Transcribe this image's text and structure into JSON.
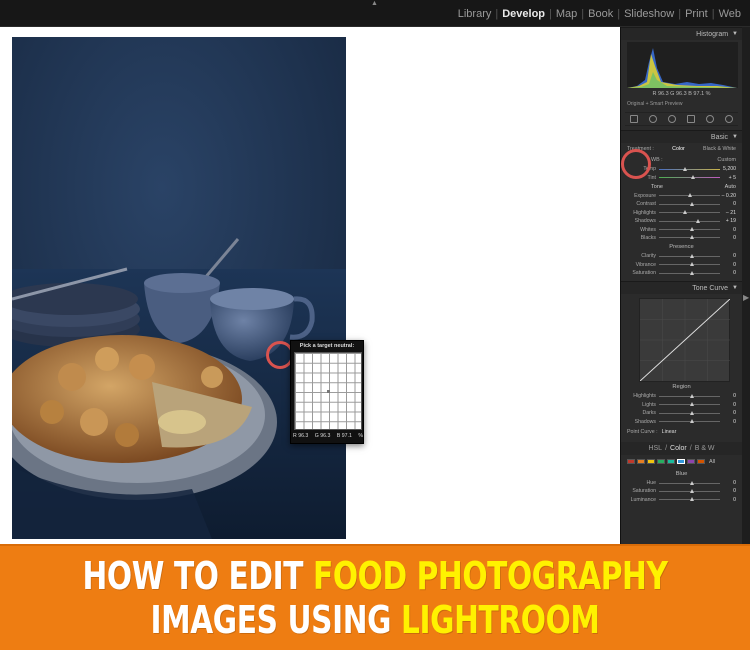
{
  "app": {
    "notch": "▲",
    "modules": [
      {
        "label": "Library",
        "active": false
      },
      {
        "label": "Develop",
        "active": true
      },
      {
        "label": "Map",
        "active": false
      },
      {
        "label": "Book",
        "active": false
      },
      {
        "label": "Slideshow",
        "active": false
      },
      {
        "label": "Print",
        "active": false
      },
      {
        "label": "Web",
        "active": false
      }
    ]
  },
  "loupe": {
    "title": "Pick a target neutral:",
    "readout": {
      "r": "R 96.3",
      "g": "G 96.3",
      "b": "B 97.1",
      "unit": "%"
    }
  },
  "panel": {
    "histogram": {
      "title": "Histogram",
      "readout": "R  96.3   G  96.3   B  97.1 %",
      "preview": "Original + Smart Preview"
    },
    "basic": {
      "title": "Basic",
      "treatment_label": "Treatment :",
      "treatment_color": "Color",
      "treatment_bw": "Black & White",
      "wb_label": "WB :",
      "wb_value": "Custom",
      "temp_label": "Temp",
      "temp_value": "5,200",
      "tint_label": "Tint",
      "tint_value": "+ 5",
      "tone_label": "Tone",
      "auto_label": "Auto",
      "sliders": [
        {
          "label": "Exposure",
          "value": "– 0.20",
          "level": 0.48
        },
        {
          "label": "Contrast",
          "value": "0",
          "level": 0.5
        },
        {
          "label": "Highlights",
          "value": "– 21",
          "level": 0.4
        },
        {
          "label": "Shadows",
          "value": "+ 19",
          "level": 0.6
        },
        {
          "label": "Whites",
          "value": "0",
          "level": 0.5
        },
        {
          "label": "Blacks",
          "value": "0",
          "level": 0.5
        }
      ],
      "presence_label": "Presence",
      "presence": [
        {
          "label": "Clarity",
          "value": "0",
          "level": 0.5
        },
        {
          "label": "Vibrance",
          "value": "0",
          "level": 0.5
        },
        {
          "label": "Saturation",
          "value": "0",
          "level": 0.5
        }
      ]
    },
    "tone_curve": {
      "title": "Tone Curve",
      "region_label": "Region",
      "regions": [
        {
          "label": "Highlights",
          "value": "0",
          "level": 0.5
        },
        {
          "label": "Lights",
          "value": "0",
          "level": 0.5
        },
        {
          "label": "Darks",
          "value": "0",
          "level": 0.5
        },
        {
          "label": "Shadows",
          "value": "0",
          "level": 0.5
        }
      ],
      "point_curve_label": "Point Curve :",
      "point_curve_value": "Linear"
    },
    "hsl": {
      "tab_hsl": "HSL",
      "sep1": "/",
      "tab_color": "Color",
      "sep2": "/",
      "tab_bw": "B & W",
      "all_label": "All",
      "swatch_colors": [
        "#c0392b",
        "#e67e22",
        "#f1c40f",
        "#27ae60",
        "#1abc9c",
        "#3498db",
        "#8e44ad",
        "#d35400"
      ],
      "selected_color": "Blue",
      "sliders": [
        {
          "label": "Hue",
          "value": "0",
          "level": 0.5
        },
        {
          "label": "Saturation",
          "value": "0",
          "level": 0.5
        },
        {
          "label": "Luminance",
          "value": "0",
          "level": 0.5
        }
      ]
    }
  },
  "banner": {
    "line1_a": "HOW TO EDIT ",
    "line1_b": "FOOD PHOTOGRAPHY",
    "line2_a": "IMAGES USING ",
    "line2_b": "LIGHTROOM"
  }
}
